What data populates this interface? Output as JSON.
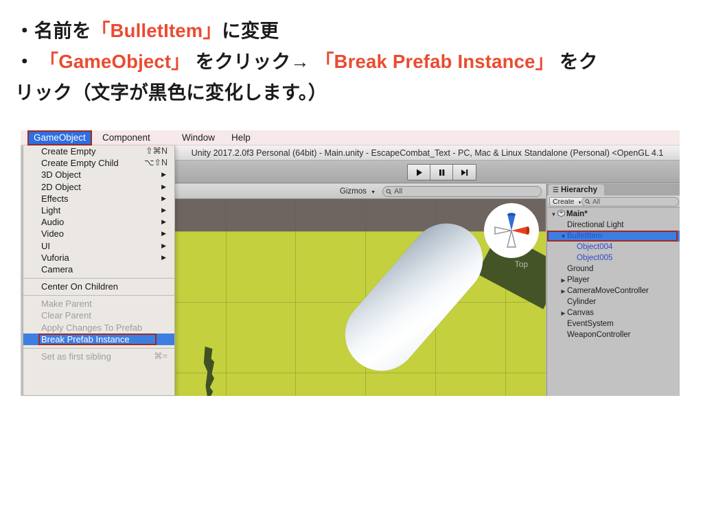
{
  "slide": {
    "line1_pre": "・名前を",
    "line1_hl": "「BulletItem」",
    "line1_post": "に変更",
    "line2_pre": "・ ",
    "line2_hl1": "「GameObject」",
    "line2_mid": " をクリック→ ",
    "line2_hl2": "「Break Prefab Instance」",
    "line2_post": " をク",
    "line3": "リック（文字が黒色に変化します。）"
  },
  "colors": {
    "accent_red": "#eb4b31",
    "selection_blue": "#3e7ee0",
    "annotation_red": "#9c2b20",
    "prefab_blue": "#2e4cc9",
    "ground_green": "#c4d03d",
    "sky_gray": "#6f6560"
  },
  "menubar": {
    "items": [
      {
        "label": "GameObject",
        "active": true
      },
      {
        "label": "Component",
        "active": false
      },
      {
        "label": "Window",
        "active": false
      },
      {
        "label": "Help",
        "active": false
      }
    ]
  },
  "gameobject_menu": {
    "groups": [
      {
        "items": [
          {
            "label": "Create Empty",
            "shortcut": "⇧⌘N",
            "submenu": false,
            "disabled": false,
            "selected": false
          },
          {
            "label": "Create Empty Child",
            "shortcut": "⌥⇧N",
            "submenu": false,
            "disabled": false,
            "selected": false
          },
          {
            "label": "3D Object",
            "shortcut": "",
            "submenu": true,
            "disabled": false,
            "selected": false
          },
          {
            "label": "2D Object",
            "shortcut": "",
            "submenu": true,
            "disabled": false,
            "selected": false
          },
          {
            "label": "Effects",
            "shortcut": "",
            "submenu": true,
            "disabled": false,
            "selected": false
          },
          {
            "label": "Light",
            "shortcut": "",
            "submenu": true,
            "disabled": false,
            "selected": false
          },
          {
            "label": "Audio",
            "shortcut": "",
            "submenu": true,
            "disabled": false,
            "selected": false
          },
          {
            "label": "Video",
            "shortcut": "",
            "submenu": true,
            "disabled": false,
            "selected": false
          },
          {
            "label": "UI",
            "shortcut": "",
            "submenu": true,
            "disabled": false,
            "selected": false
          },
          {
            "label": "Vuforia",
            "shortcut": "",
            "submenu": true,
            "disabled": false,
            "selected": false
          },
          {
            "label": "Camera",
            "shortcut": "",
            "submenu": false,
            "disabled": false,
            "selected": false
          }
        ]
      },
      {
        "items": [
          {
            "label": "Center On Children",
            "shortcut": "",
            "submenu": false,
            "disabled": false,
            "selected": false
          }
        ]
      },
      {
        "items": [
          {
            "label": "Make Parent",
            "shortcut": "",
            "submenu": false,
            "disabled": true,
            "selected": false
          },
          {
            "label": "Clear Parent",
            "shortcut": "",
            "submenu": false,
            "disabled": true,
            "selected": false
          },
          {
            "label": "Apply Changes To Prefab",
            "shortcut": "",
            "submenu": false,
            "disabled": true,
            "selected": false
          },
          {
            "label": "Break Prefab Instance",
            "shortcut": "",
            "submenu": false,
            "disabled": false,
            "selected": true
          }
        ]
      },
      {
        "items": [
          {
            "label": "Set as first sibling",
            "shortcut": "⌘=",
            "submenu": false,
            "disabled": true,
            "selected": false
          }
        ]
      }
    ]
  },
  "unity": {
    "title": "Unity 2017.2.0f3 Personal (64bit) - Main.unity - EscapeCombat_Text - PC, Mac & Linux Standalone (Personal) <OpenGL 4.1",
    "transport": [
      {
        "name": "play-button",
        "glyph": "play"
      },
      {
        "name": "pause-button",
        "glyph": "pause"
      },
      {
        "name": "step-button",
        "glyph": "step"
      }
    ]
  },
  "scene_view": {
    "gizmos_label": "Gizmos",
    "search_value": "All",
    "search_prefix": "Q",
    "gizmo_orientation_label": "Top"
  },
  "hierarchy": {
    "tab_label": "Hierarchy",
    "create_label": "Create",
    "search_value": "All",
    "search_prefix": "Q",
    "rows": [
      {
        "label": "Main*",
        "indent": 0,
        "triangle": "▼",
        "unity_icon": true,
        "bold": true,
        "selected": false,
        "prefab": false
      },
      {
        "label": "Directional Light",
        "indent": 1,
        "triangle": "",
        "unity_icon": false,
        "bold": false,
        "selected": false,
        "prefab": false
      },
      {
        "label": "BulletItem",
        "indent": 1,
        "triangle": "▼",
        "unity_icon": false,
        "bold": false,
        "selected": true,
        "prefab": true
      },
      {
        "label": "Object004",
        "indent": 2,
        "triangle": "",
        "unity_icon": false,
        "bold": false,
        "selected": false,
        "prefab": true
      },
      {
        "label": "Object005",
        "indent": 2,
        "triangle": "",
        "unity_icon": false,
        "bold": false,
        "selected": false,
        "prefab": true
      },
      {
        "label": "Ground",
        "indent": 1,
        "triangle": "",
        "unity_icon": false,
        "bold": false,
        "selected": false,
        "prefab": false
      },
      {
        "label": "Player",
        "indent": 1,
        "triangle": "▶",
        "unity_icon": false,
        "bold": false,
        "selected": false,
        "prefab": false
      },
      {
        "label": "CameraMoveController",
        "indent": 1,
        "triangle": "▶",
        "unity_icon": false,
        "bold": false,
        "selected": false,
        "prefab": false
      },
      {
        "label": "Cylinder",
        "indent": 1,
        "triangle": "",
        "unity_icon": false,
        "bold": false,
        "selected": false,
        "prefab": false
      },
      {
        "label": "Canvas",
        "indent": 1,
        "triangle": "▶",
        "unity_icon": false,
        "bold": false,
        "selected": false,
        "prefab": false
      },
      {
        "label": "EventSystem",
        "indent": 1,
        "triangle": "",
        "unity_icon": false,
        "bold": false,
        "selected": false,
        "prefab": false
      },
      {
        "label": "WeaponController",
        "indent": 1,
        "triangle": "",
        "unity_icon": false,
        "bold": false,
        "selected": false,
        "prefab": false
      }
    ]
  }
}
